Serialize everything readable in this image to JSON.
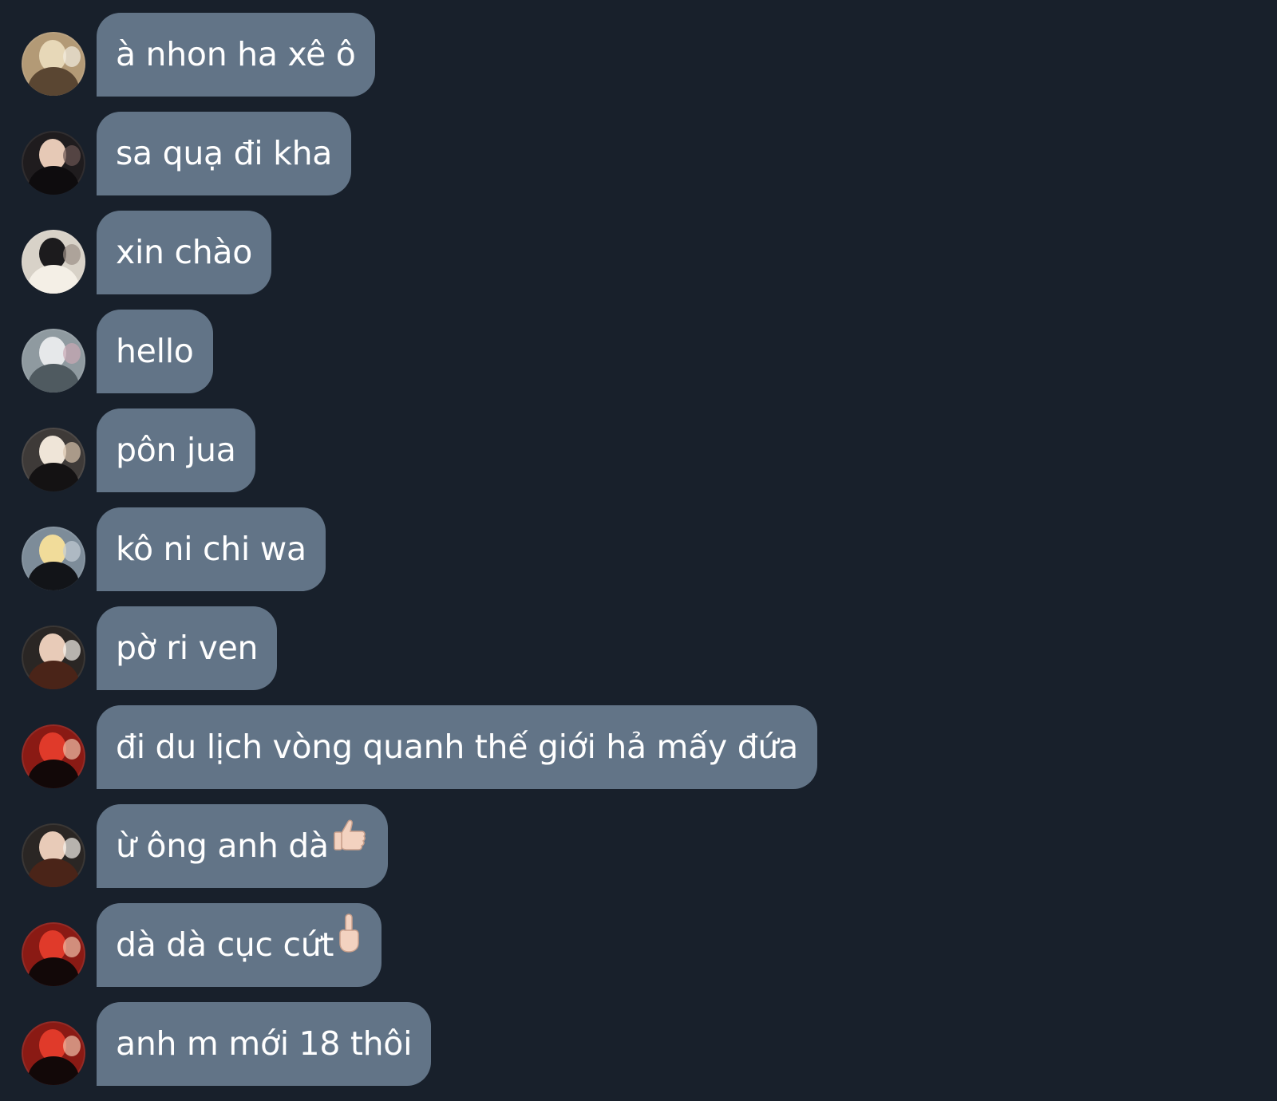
{
  "messages": [
    {
      "text": "à nhon ha xê ô",
      "emoji": "",
      "avatar": {
        "name": "user-avatar-1",
        "bg": "#b39a76",
        "c1": "#e7d8b8",
        "c2": "#5a4632",
        "c3": "#f2ece0"
      }
    },
    {
      "text": "sa quạ đi kha",
      "emoji": "",
      "avatar": {
        "name": "user-avatar-2",
        "bg": "#1f1c1e",
        "c1": "#e6c9b6",
        "c2": "#0e0c0e",
        "c3": "#6b5652"
      }
    },
    {
      "text": "xin chào",
      "emoji": "",
      "avatar": {
        "name": "user-avatar-3",
        "bg": "#d8d2c8",
        "c1": "#1c1b1d",
        "c2": "#f4efe6",
        "c3": "#9b8f86"
      }
    },
    {
      "text": "hello",
      "emoji": "",
      "avatar": {
        "name": "user-avatar-4",
        "bg": "#8f9aa0",
        "c1": "#e6e8ea",
        "c2": "#4f5a60",
        "c3": "#c9a8b4"
      }
    },
    {
      "text": "pôn jua",
      "emoji": "",
      "avatar": {
        "name": "user-avatar-5",
        "bg": "#3e3a38",
        "c1": "#efe5d8",
        "c2": "#141213",
        "c3": "#d9c3ad"
      }
    },
    {
      "text": "kô ni chi wa",
      "emoji": "",
      "avatar": {
        "name": "user-avatar-6",
        "bg": "#7d8c99",
        "c1": "#f1dc9a",
        "c2": "#121418",
        "c3": "#c3ccd4"
      }
    },
    {
      "text": "pờ ri ven",
      "emoji": "",
      "avatar": {
        "name": "user-avatar-7",
        "bg": "#2a2624",
        "c1": "#e8cbb8",
        "c2": "#4a2418",
        "c3": "#f3f0ea"
      }
    },
    {
      "text": "đi du lịch vòng quanh thế giới hả mấy đứa",
      "emoji": "",
      "avatar": {
        "name": "user-avatar-8",
        "bg": "#8a1a14",
        "c1": "#e03a2a",
        "c2": "#120808",
        "c3": "#f0c0a8"
      }
    },
    {
      "text": "ừ ông anh dà",
      "emoji": "thumbs-up",
      "avatar": {
        "name": "user-avatar-9",
        "bg": "#2a2624",
        "c1": "#e8cbb8",
        "c2": "#4a2418",
        "c3": "#f3f0ea"
      }
    },
    {
      "text": "dà dà cục cứt",
      "emoji": "middle-finger",
      "avatar": {
        "name": "user-avatar-10",
        "bg": "#8a1a14",
        "c1": "#e03a2a",
        "c2": "#120808",
        "c3": "#f0c0a8"
      }
    },
    {
      "text": "anh m mới 18 thôi",
      "emoji": "",
      "avatar": {
        "name": "user-avatar-11",
        "bg": "#8a1a14",
        "c1": "#e03a2a",
        "c2": "#120808",
        "c3": "#f0c0a8"
      }
    }
  ],
  "colors": {
    "background": "#18202b",
    "bubble": "#627487",
    "text": "#ffffff",
    "emoji_skin": "#f3d2c0"
  }
}
